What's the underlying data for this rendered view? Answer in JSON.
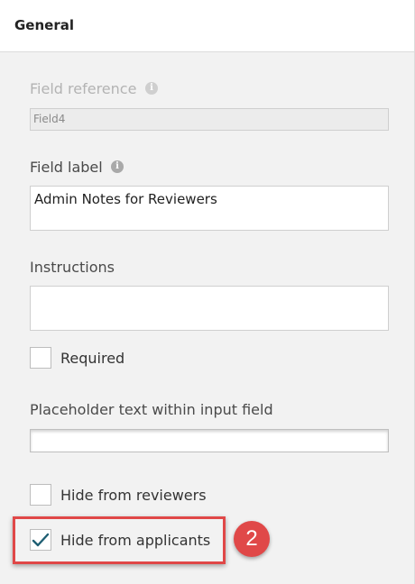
{
  "header": {
    "title": "General"
  },
  "field_reference": {
    "label": "Field reference",
    "value": "Field4",
    "info_icon": "info-icon"
  },
  "field_label": {
    "label": "Field label",
    "value": "Admin Notes for Reviewers",
    "info_icon": "info-icon"
  },
  "instructions": {
    "label": "Instructions",
    "value": ""
  },
  "required": {
    "label": "Required",
    "checked": false
  },
  "placeholder_text": {
    "label": "Placeholder text within input field",
    "value": ""
  },
  "hide_from_reviewers": {
    "label": "Hide from reviewers",
    "checked": false
  },
  "hide_from_applicants": {
    "label": "Hide from applicants",
    "checked": true
  },
  "annotation": {
    "step_number": "2",
    "color": "#e04848"
  },
  "colors": {
    "checkmark": "#1f5f73",
    "background": "#f2f2f2",
    "header": "#ffffff"
  }
}
